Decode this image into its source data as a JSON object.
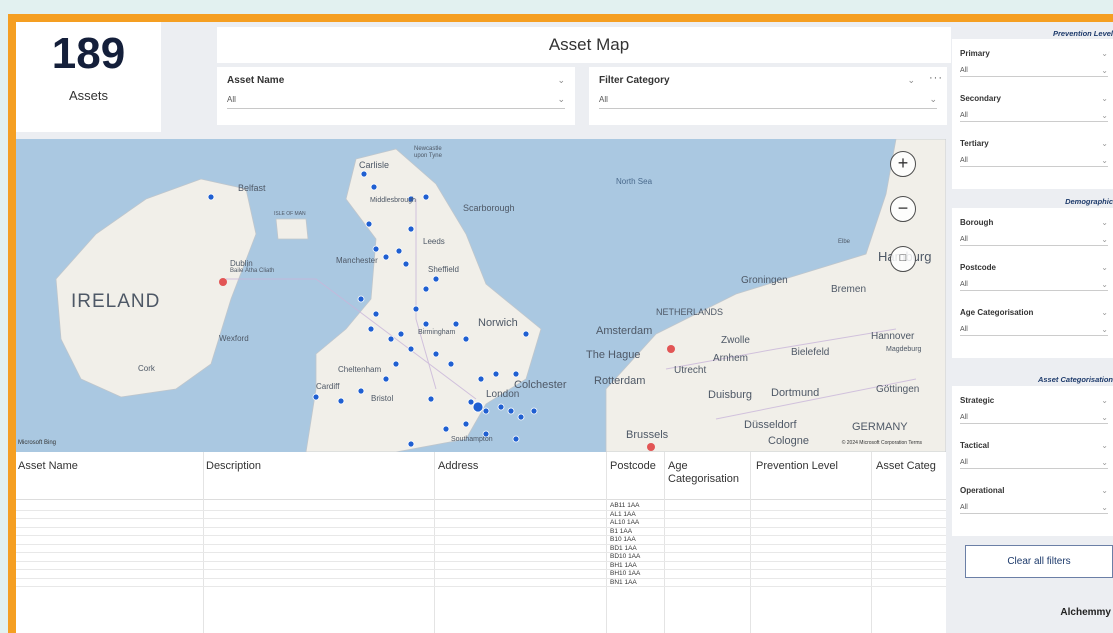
{
  "kpi": {
    "value": "189",
    "label": "Assets"
  },
  "title": "Asset Map",
  "top_slicers": [
    {
      "label": "Asset Name",
      "value": "All"
    },
    {
      "label": "Filter Category",
      "value": "All"
    }
  ],
  "more_icon": "···",
  "map": {
    "labels": {
      "ireland": "IRELAND",
      "belfast": "Belfast",
      "dublin": "Dublin",
      "dublin_irish": "Baile Átha Cliath",
      "isle_of_man": "ISLE OF MAN",
      "carlisle": "Carlisle",
      "newcastle": "Newcastle",
      "newcastle2": "upon Tyne",
      "middlesbrough": "Middlesbrough",
      "scarborough": "Scarborough",
      "leeds": "Leeds",
      "manchester": "Manchester",
      "sheffield": "Sheffield",
      "birmingham": "Birmingham",
      "norwich": "Norwich",
      "wexford": "Wexford",
      "cork": "Cork",
      "cheltenham": "Cheltenham",
      "cardiff": "Cardiff",
      "bristol": "Bristol",
      "london": "London",
      "colchester": "Colchester",
      "southampton": "Southampton",
      "north_sea": "North Sea",
      "amsterdam": "Amsterdam",
      "the_hague": "The Hague",
      "rotterdam": "Rotterdam",
      "utrecht": "Utrecht",
      "netherlands": "NETHERLANDS",
      "zwolle": "Zwolle",
      "arnhem": "Arnhem",
      "groningen": "Groningen",
      "bremen": "Bremen",
      "hamburg": "Hamburg",
      "elbe": "Elbe",
      "hannover": "Hannover",
      "magdeburg": "Magdeburg",
      "bielefeld": "Bielefeld",
      "dortmund": "Dortmund",
      "gottingen": "Göttingen",
      "duisburg": "Duisburg",
      "dusseldorf": "Düsseldorf",
      "cologne": "Cologne",
      "germany": "GERMANY",
      "brussels": "Brussels"
    },
    "bing": "Microsoft Bing",
    "copyright": "© 2024 Microsoft Corporation  Terms",
    "colors": {
      "sea": "#aac8e1",
      "land": "#f1efe9",
      "point": "#1f5fd1",
      "city": "#e25555"
    }
  },
  "table": {
    "columns": [
      "Asset Name",
      "Description",
      "Address",
      "Postcode",
      "Age Categorisation",
      "Prevention Level",
      "Asset Categ"
    ],
    "postcodes": [
      "AB11 1AA",
      "AL1 1AA",
      "AL10 1AA",
      "B1 1AA",
      "B10 1AA",
      "BD1 1AA",
      "BD10 1AA",
      "BH1 1AA",
      "BH10 1AA",
      "BN1 1AA"
    ]
  },
  "right_panel": {
    "sections": [
      {
        "header": "Prevention Level",
        "slicers": [
          {
            "label": "Primary",
            "value": "All"
          },
          {
            "label": "Secondary",
            "value": "All"
          },
          {
            "label": "Tertiary",
            "value": "All"
          }
        ]
      },
      {
        "header": "Demographic",
        "slicers": [
          {
            "label": "Borough",
            "value": "All"
          },
          {
            "label": "Postcode",
            "value": "All"
          },
          {
            "label": "Age Categorisation",
            "value": "All"
          }
        ]
      },
      {
        "header": "Asset Categorisation",
        "slicers": [
          {
            "label": "Strategic",
            "value": "All"
          },
          {
            "label": "Tactical",
            "value": "All"
          },
          {
            "label": "Operational",
            "value": "All"
          }
        ]
      }
    ],
    "clear_button": "Clear all filters",
    "brand": "Alchemmy"
  }
}
